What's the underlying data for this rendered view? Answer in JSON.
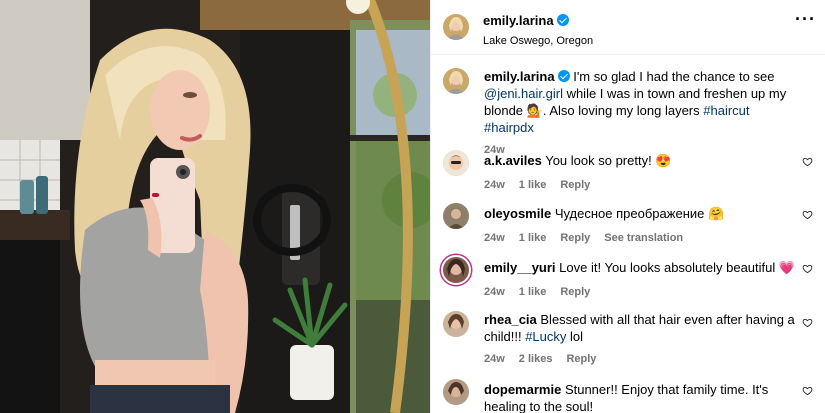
{
  "header": {
    "username": "emily.larina",
    "location": "Lake Oswego, Oregon"
  },
  "caption": {
    "username": "emily.larina",
    "text_before_mention": "I'm so glad I had the chance to see ",
    "mention": "@jeni.hair.girl",
    "text_after_mention": " while I was in town and freshen up my blonde 💁. Also loving my long layers ",
    "hashtag1": "#haircut",
    "hashtag2": "#hairpdx",
    "time": "24w"
  },
  "comments": [
    {
      "username": "a.k.aviles",
      "text": "You look so pretty! 😍",
      "time": "24w",
      "likes": "1 like",
      "reply": "Reply"
    },
    {
      "username": "oleyosmile",
      "text": "Чудесное преображение 🤗",
      "time": "24w",
      "likes": "1 like",
      "reply": "Reply",
      "translate": "See translation"
    },
    {
      "username": "emily__yuri",
      "text": "Love it! You looks absolutely beautiful 💗",
      "time": "24w",
      "likes": "1 like",
      "reply": "Reply"
    },
    {
      "username": "rhea_cia",
      "text_before": "Blessed with all that hair even after having a child!!! ",
      "hashtag": "#Lucky",
      "text_after": " lol",
      "time": "24w",
      "likes": "2 likes",
      "reply": "Reply"
    },
    {
      "username": "dopemarmie",
      "text": "Stunner!! Enjoy that family time. It's healing to the soul!"
    }
  ],
  "icons": {
    "verified": "verified-badge-icon",
    "more": "more-options-icon",
    "like": "heart-icon"
  },
  "colors": {
    "link": "#00376b",
    "verified": "#0095f6",
    "meta": "#737373"
  }
}
